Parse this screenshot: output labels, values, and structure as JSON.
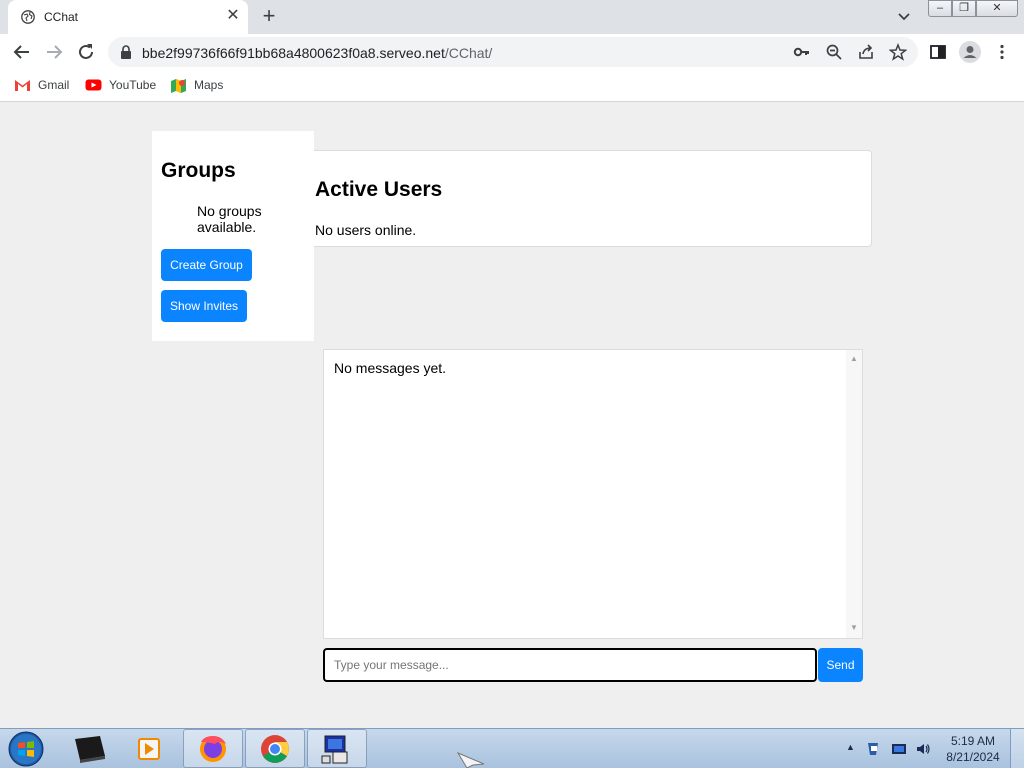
{
  "browser": {
    "tab_title": "CChat",
    "tab_close": "✕",
    "new_tab": "+",
    "url_host": "bbe2f99736f66f91bb68a4800623f0a8.serveo.net",
    "url_path": "/CChat/",
    "bookmarks": [
      "Gmail",
      "YouTube",
      "Maps"
    ],
    "window_controls": [
      "–",
      "❐",
      "✕"
    ]
  },
  "groups": {
    "title": "Groups",
    "empty_text": "No groups available.",
    "create_button": "Create Group",
    "invites_button": "Show Invites"
  },
  "users": {
    "title": "Active Users",
    "empty_text": "No users online."
  },
  "messages": {
    "empty_text": "No messages yet.",
    "input_placeholder": "Type your message...",
    "send_button": "Send"
  },
  "taskbar": {
    "time": "5:19 AM",
    "date": "8/21/2024",
    "apps": [
      "media-center-icon",
      "media-player-icon",
      "firefox-icon",
      "chrome-icon",
      "network-app-icon"
    ]
  },
  "colors": {
    "accent": "#0a84ff",
    "page_bg": "#efefef"
  }
}
